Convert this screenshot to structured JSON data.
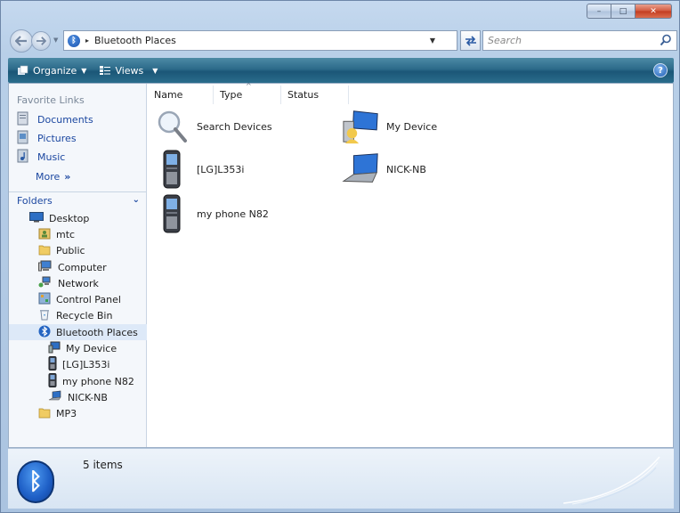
{
  "window": {
    "buttons": {
      "minimize": "–",
      "maximize": "□",
      "close": "✕"
    }
  },
  "address_bar": {
    "location": "Bluetooth Places",
    "separator": "▸"
  },
  "search": {
    "placeholder": "Search"
  },
  "toolbar": {
    "organize": "Organize",
    "views": "Views",
    "help": "?"
  },
  "nav_pane": {
    "favorite_links_title": "Favorite Links",
    "favorites": [
      {
        "label": "Documents",
        "icon": "documents-icon"
      },
      {
        "label": "Pictures",
        "icon": "pictures-icon"
      },
      {
        "label": "Music",
        "icon": "music-icon"
      }
    ],
    "more": "More",
    "more_glyph": "»",
    "folders_title": "Folders",
    "tree": [
      {
        "label": "Desktop",
        "icon": "desktop-icon",
        "level": 0
      },
      {
        "label": "mtc",
        "icon": "user-folder-icon",
        "level": 1
      },
      {
        "label": "Public",
        "icon": "folder-icon",
        "level": 1
      },
      {
        "label": "Computer",
        "icon": "computer-icon",
        "level": 1
      },
      {
        "label": "Network",
        "icon": "network-icon",
        "level": 1
      },
      {
        "label": "Control Panel",
        "icon": "control-panel-icon",
        "level": 1
      },
      {
        "label": "Recycle Bin",
        "icon": "recycle-bin-icon",
        "level": 1
      },
      {
        "label": "Bluetooth Places",
        "icon": "bluetooth-icon",
        "level": 1,
        "selected": true
      },
      {
        "label": "My Device",
        "icon": "my-device-icon",
        "level": 2
      },
      {
        "label": "[LG]L353i",
        "icon": "phone-icon",
        "level": 2
      },
      {
        "label": "my phone N82",
        "icon": "phone-icon",
        "level": 2
      },
      {
        "label": "NICK-NB",
        "icon": "laptop-icon",
        "level": 2
      },
      {
        "label": "MP3",
        "icon": "folder-icon",
        "level": 1
      }
    ]
  },
  "columns": {
    "name": "Name",
    "type": "Type",
    "status": "Status"
  },
  "items": [
    {
      "label": "Search Devices",
      "icon": "magnifier-icon"
    },
    {
      "label": "My Device",
      "icon": "my-device-icon"
    },
    {
      "label": "[LG]L353i",
      "icon": "phone-icon"
    },
    {
      "label": "NICK-NB",
      "icon": "laptop-icon"
    },
    {
      "label": "my phone N82",
      "icon": "phone-icon"
    }
  ],
  "status": {
    "count": "5 items"
  }
}
